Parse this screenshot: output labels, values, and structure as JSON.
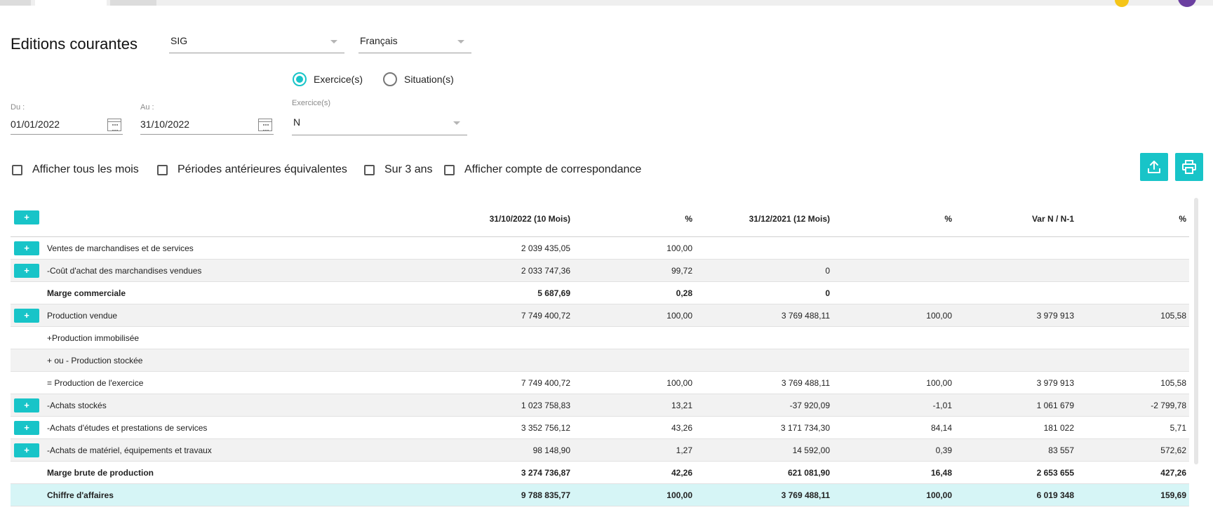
{
  "page": {
    "title": "Editions courantes",
    "report_select": "SIG",
    "language_select": "Français"
  },
  "mode": {
    "options": [
      {
        "label": "Exercice(s)",
        "checked": true
      },
      {
        "label": "Situation(s)",
        "checked": false
      }
    ]
  },
  "dates": {
    "from_label": "Du :",
    "from_value": "01/01/2022",
    "to_label": "Au :",
    "to_value": "31/10/2022",
    "exercice_label": "Exercice(s)",
    "exercice_value": "N"
  },
  "options": [
    {
      "label": "Afficher tous les mois",
      "checked": false
    },
    {
      "label": "Périodes antérieures équivalentes",
      "checked": false
    },
    {
      "label": "Sur 3 ans",
      "checked": false
    },
    {
      "label": "Afficher compte de correspondance",
      "checked": false
    }
  ],
  "actions": {
    "export_icon": "upload-icon",
    "print_icon": "printer-icon"
  },
  "colors": {
    "accent": "#18c4c8",
    "highlight_row": "#d6f5f6",
    "badge": "#f5c518",
    "avatar": "#6b3fa0"
  },
  "table": {
    "expand_label": "+",
    "headers": {
      "period_n": "31/10/2022 (10 Mois)",
      "pct_n": "%",
      "period_n1": "31/12/2021 (12 Mois)",
      "pct_n1": "%",
      "var": "Var N / N-1",
      "pct_var": "%"
    },
    "rows": [
      {
        "label": "Ventes de marchandises et de services",
        "n": "2 039 435,05",
        "pn": "100,00",
        "n1": "",
        "pn1": "",
        "var": "",
        "pvar": ""
      },
      {
        "label": "-Coût d'achat des marchandises vendues",
        "n": "2 033 747,36",
        "pn": "99,72",
        "n1": "0",
        "pn1": "",
        "var": "",
        "pvar": ""
      },
      {
        "label": "Marge commerciale",
        "n": "5 687,69",
        "pn": "0,28",
        "n1": "0",
        "pn1": "",
        "var": "",
        "pvar": ""
      },
      {
        "label": "Production vendue",
        "n": "7 749 400,72",
        "pn": "100,00",
        "n1": "3 769 488,11",
        "pn1": "100,00",
        "var": "3 979 913",
        "pvar": "105,58"
      },
      {
        "label": "+Production immobilisée",
        "n": "",
        "pn": "",
        "n1": "",
        "pn1": "",
        "var": "",
        "pvar": ""
      },
      {
        "label": "+ ou - Production stockée",
        "n": "",
        "pn": "",
        "n1": "",
        "pn1": "",
        "var": "",
        "pvar": ""
      },
      {
        "label": "= Production de l'exercice",
        "n": "7 749 400,72",
        "pn": "100,00",
        "n1": "3 769 488,11",
        "pn1": "100,00",
        "var": "3 979 913",
        "pvar": "105,58"
      },
      {
        "label": "-Achats stockés",
        "n": "1 023 758,83",
        "pn": "13,21",
        "n1": "-37 920,09",
        "pn1": "-1,01",
        "var": "1 061 679",
        "pvar": "-2 799,78"
      },
      {
        "label": "-Achats d'études et prestations de services",
        "n": "3 352 756,12",
        "pn": "43,26",
        "n1": "3 171 734,30",
        "pn1": "84,14",
        "var": "181 022",
        "pvar": "5,71"
      },
      {
        "label": "-Achats de matériel, équipements et travaux",
        "n": "98 148,90",
        "pn": "1,27",
        "n1": "14 592,00",
        "pn1": "0,39",
        "var": "83 557",
        "pvar": "572,62"
      },
      {
        "label": "Marge brute de production",
        "n": "3 274 736,87",
        "pn": "42,26",
        "n1": "621 081,90",
        "pn1": "16,48",
        "var": "2 653 655",
        "pvar": "427,26"
      },
      {
        "label": "Chiffre d'affaires",
        "n": "9 788 835,77",
        "pn": "100,00",
        "n1": "3 769 488,11",
        "pn1": "100,00",
        "var": "6 019 348",
        "pvar": "159,69"
      }
    ]
  }
}
